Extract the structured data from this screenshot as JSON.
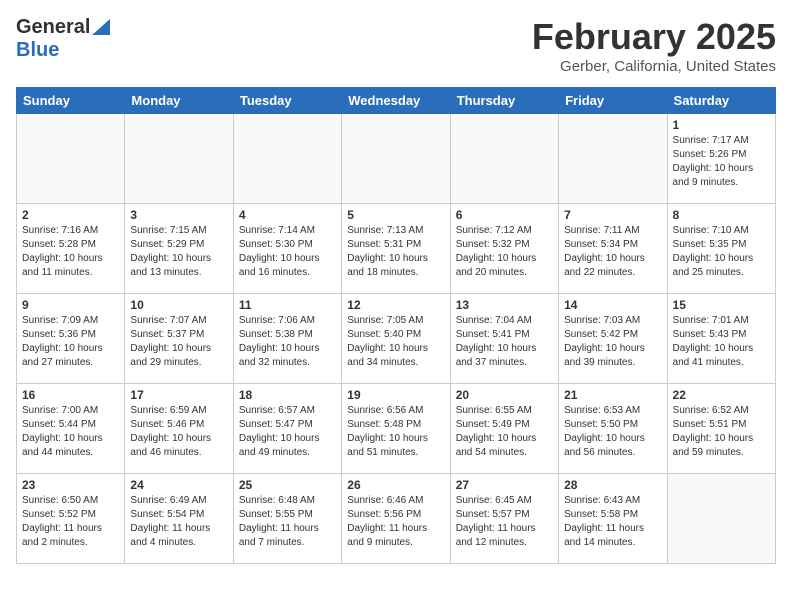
{
  "header": {
    "logo_general": "General",
    "logo_blue": "Blue",
    "month": "February 2025",
    "location": "Gerber, California, United States"
  },
  "days_of_week": [
    "Sunday",
    "Monday",
    "Tuesday",
    "Wednesday",
    "Thursday",
    "Friday",
    "Saturday"
  ],
  "weeks": [
    [
      {
        "day": "",
        "info": ""
      },
      {
        "day": "",
        "info": ""
      },
      {
        "day": "",
        "info": ""
      },
      {
        "day": "",
        "info": ""
      },
      {
        "day": "",
        "info": ""
      },
      {
        "day": "",
        "info": ""
      },
      {
        "day": "1",
        "info": "Sunrise: 7:17 AM\nSunset: 5:26 PM\nDaylight: 10 hours\nand 9 minutes."
      }
    ],
    [
      {
        "day": "2",
        "info": "Sunrise: 7:16 AM\nSunset: 5:28 PM\nDaylight: 10 hours\nand 11 minutes."
      },
      {
        "day": "3",
        "info": "Sunrise: 7:15 AM\nSunset: 5:29 PM\nDaylight: 10 hours\nand 13 minutes."
      },
      {
        "day": "4",
        "info": "Sunrise: 7:14 AM\nSunset: 5:30 PM\nDaylight: 10 hours\nand 16 minutes."
      },
      {
        "day": "5",
        "info": "Sunrise: 7:13 AM\nSunset: 5:31 PM\nDaylight: 10 hours\nand 18 minutes."
      },
      {
        "day": "6",
        "info": "Sunrise: 7:12 AM\nSunset: 5:32 PM\nDaylight: 10 hours\nand 20 minutes."
      },
      {
        "day": "7",
        "info": "Sunrise: 7:11 AM\nSunset: 5:34 PM\nDaylight: 10 hours\nand 22 minutes."
      },
      {
        "day": "8",
        "info": "Sunrise: 7:10 AM\nSunset: 5:35 PM\nDaylight: 10 hours\nand 25 minutes."
      }
    ],
    [
      {
        "day": "9",
        "info": "Sunrise: 7:09 AM\nSunset: 5:36 PM\nDaylight: 10 hours\nand 27 minutes."
      },
      {
        "day": "10",
        "info": "Sunrise: 7:07 AM\nSunset: 5:37 PM\nDaylight: 10 hours\nand 29 minutes."
      },
      {
        "day": "11",
        "info": "Sunrise: 7:06 AM\nSunset: 5:38 PM\nDaylight: 10 hours\nand 32 minutes."
      },
      {
        "day": "12",
        "info": "Sunrise: 7:05 AM\nSunset: 5:40 PM\nDaylight: 10 hours\nand 34 minutes."
      },
      {
        "day": "13",
        "info": "Sunrise: 7:04 AM\nSunset: 5:41 PM\nDaylight: 10 hours\nand 37 minutes."
      },
      {
        "day": "14",
        "info": "Sunrise: 7:03 AM\nSunset: 5:42 PM\nDaylight: 10 hours\nand 39 minutes."
      },
      {
        "day": "15",
        "info": "Sunrise: 7:01 AM\nSunset: 5:43 PM\nDaylight: 10 hours\nand 41 minutes."
      }
    ],
    [
      {
        "day": "16",
        "info": "Sunrise: 7:00 AM\nSunset: 5:44 PM\nDaylight: 10 hours\nand 44 minutes."
      },
      {
        "day": "17",
        "info": "Sunrise: 6:59 AM\nSunset: 5:46 PM\nDaylight: 10 hours\nand 46 minutes."
      },
      {
        "day": "18",
        "info": "Sunrise: 6:57 AM\nSunset: 5:47 PM\nDaylight: 10 hours\nand 49 minutes."
      },
      {
        "day": "19",
        "info": "Sunrise: 6:56 AM\nSunset: 5:48 PM\nDaylight: 10 hours\nand 51 minutes."
      },
      {
        "day": "20",
        "info": "Sunrise: 6:55 AM\nSunset: 5:49 PM\nDaylight: 10 hours\nand 54 minutes."
      },
      {
        "day": "21",
        "info": "Sunrise: 6:53 AM\nSunset: 5:50 PM\nDaylight: 10 hours\nand 56 minutes."
      },
      {
        "day": "22",
        "info": "Sunrise: 6:52 AM\nSunset: 5:51 PM\nDaylight: 10 hours\nand 59 minutes."
      }
    ],
    [
      {
        "day": "23",
        "info": "Sunrise: 6:50 AM\nSunset: 5:52 PM\nDaylight: 11 hours\nand 2 minutes."
      },
      {
        "day": "24",
        "info": "Sunrise: 6:49 AM\nSunset: 5:54 PM\nDaylight: 11 hours\nand 4 minutes."
      },
      {
        "day": "25",
        "info": "Sunrise: 6:48 AM\nSunset: 5:55 PM\nDaylight: 11 hours\nand 7 minutes."
      },
      {
        "day": "26",
        "info": "Sunrise: 6:46 AM\nSunset: 5:56 PM\nDaylight: 11 hours\nand 9 minutes."
      },
      {
        "day": "27",
        "info": "Sunrise: 6:45 AM\nSunset: 5:57 PM\nDaylight: 11 hours\nand 12 minutes."
      },
      {
        "day": "28",
        "info": "Sunrise: 6:43 AM\nSunset: 5:58 PM\nDaylight: 11 hours\nand 14 minutes."
      },
      {
        "day": "",
        "info": ""
      }
    ]
  ]
}
